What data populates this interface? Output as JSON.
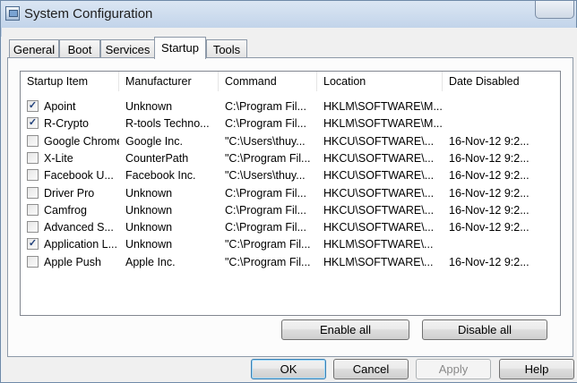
{
  "window": {
    "title": "System Configuration"
  },
  "tabs": [
    {
      "label": "General"
    },
    {
      "label": "Boot"
    },
    {
      "label": "Services"
    },
    {
      "label": "Startup"
    },
    {
      "label": "Tools"
    }
  ],
  "active_tab": "Startup",
  "columns": [
    "Startup Item",
    "Manufacturer",
    "Command",
    "Location",
    "Date Disabled"
  ],
  "rows": [
    {
      "checked": true,
      "item": "Apoint",
      "manufacturer": "Unknown",
      "command": "C:\\Program Fil...",
      "location": "HKLM\\SOFTWARE\\M...",
      "date": ""
    },
    {
      "checked": true,
      "item": "R-Crypto",
      "manufacturer": "R-tools Techno...",
      "command": "C:\\Program Fil...",
      "location": "HKLM\\SOFTWARE\\M...",
      "date": ""
    },
    {
      "checked": false,
      "item": "Google Chrome",
      "manufacturer": "Google Inc.",
      "command": "\"C:\\Users\\thuy...",
      "location": "HKCU\\SOFTWARE\\...",
      "date": "16-Nov-12 9:2..."
    },
    {
      "checked": false,
      "item": "X-Lite",
      "manufacturer": "CounterPath",
      "command": "\"C:\\Program Fil...",
      "location": "HKCU\\SOFTWARE\\...",
      "date": "16-Nov-12 9:2..."
    },
    {
      "checked": false,
      "item": "Facebook U...",
      "manufacturer": "Facebook Inc.",
      "command": "\"C:\\Users\\thuy...",
      "location": "HKCU\\SOFTWARE\\...",
      "date": "16-Nov-12 9:2..."
    },
    {
      "checked": false,
      "item": "Driver Pro",
      "manufacturer": "Unknown",
      "command": "C:\\Program Fil...",
      "location": "HKCU\\SOFTWARE\\...",
      "date": "16-Nov-12 9:2..."
    },
    {
      "checked": false,
      "item": "Camfrog",
      "manufacturer": "Unknown",
      "command": "C:\\Program Fil...",
      "location": "HKCU\\SOFTWARE\\...",
      "date": "16-Nov-12 9:2..."
    },
    {
      "checked": false,
      "item": "Advanced S...",
      "manufacturer": "Unknown",
      "command": "C:\\Program Fil...",
      "location": "HKCU\\SOFTWARE\\...",
      "date": "16-Nov-12 9:2..."
    },
    {
      "checked": true,
      "item": "Application L...",
      "manufacturer": "Unknown",
      "command": "\"C:\\Program Fil...",
      "location": "HKLM\\SOFTWARE\\...",
      "date": ""
    },
    {
      "checked": false,
      "item": "Apple Push",
      "manufacturer": "Apple Inc.",
      "command": "\"C:\\Program Fil...",
      "location": "HKLM\\SOFTWARE\\...",
      "date": "16-Nov-12 9:2..."
    }
  ],
  "buttons": {
    "enable_all": "Enable all",
    "disable_all": "Disable all",
    "ok": "OK",
    "cancel": "Cancel",
    "apply": "Apply",
    "help": "Help"
  },
  "icons": {
    "app": "msconfig-app-icon",
    "check": "checkmark-icon",
    "close": "close-icon"
  },
  "colors": {
    "selection_border": "#3c7fb1",
    "checkmark": "#1f3f7a"
  }
}
